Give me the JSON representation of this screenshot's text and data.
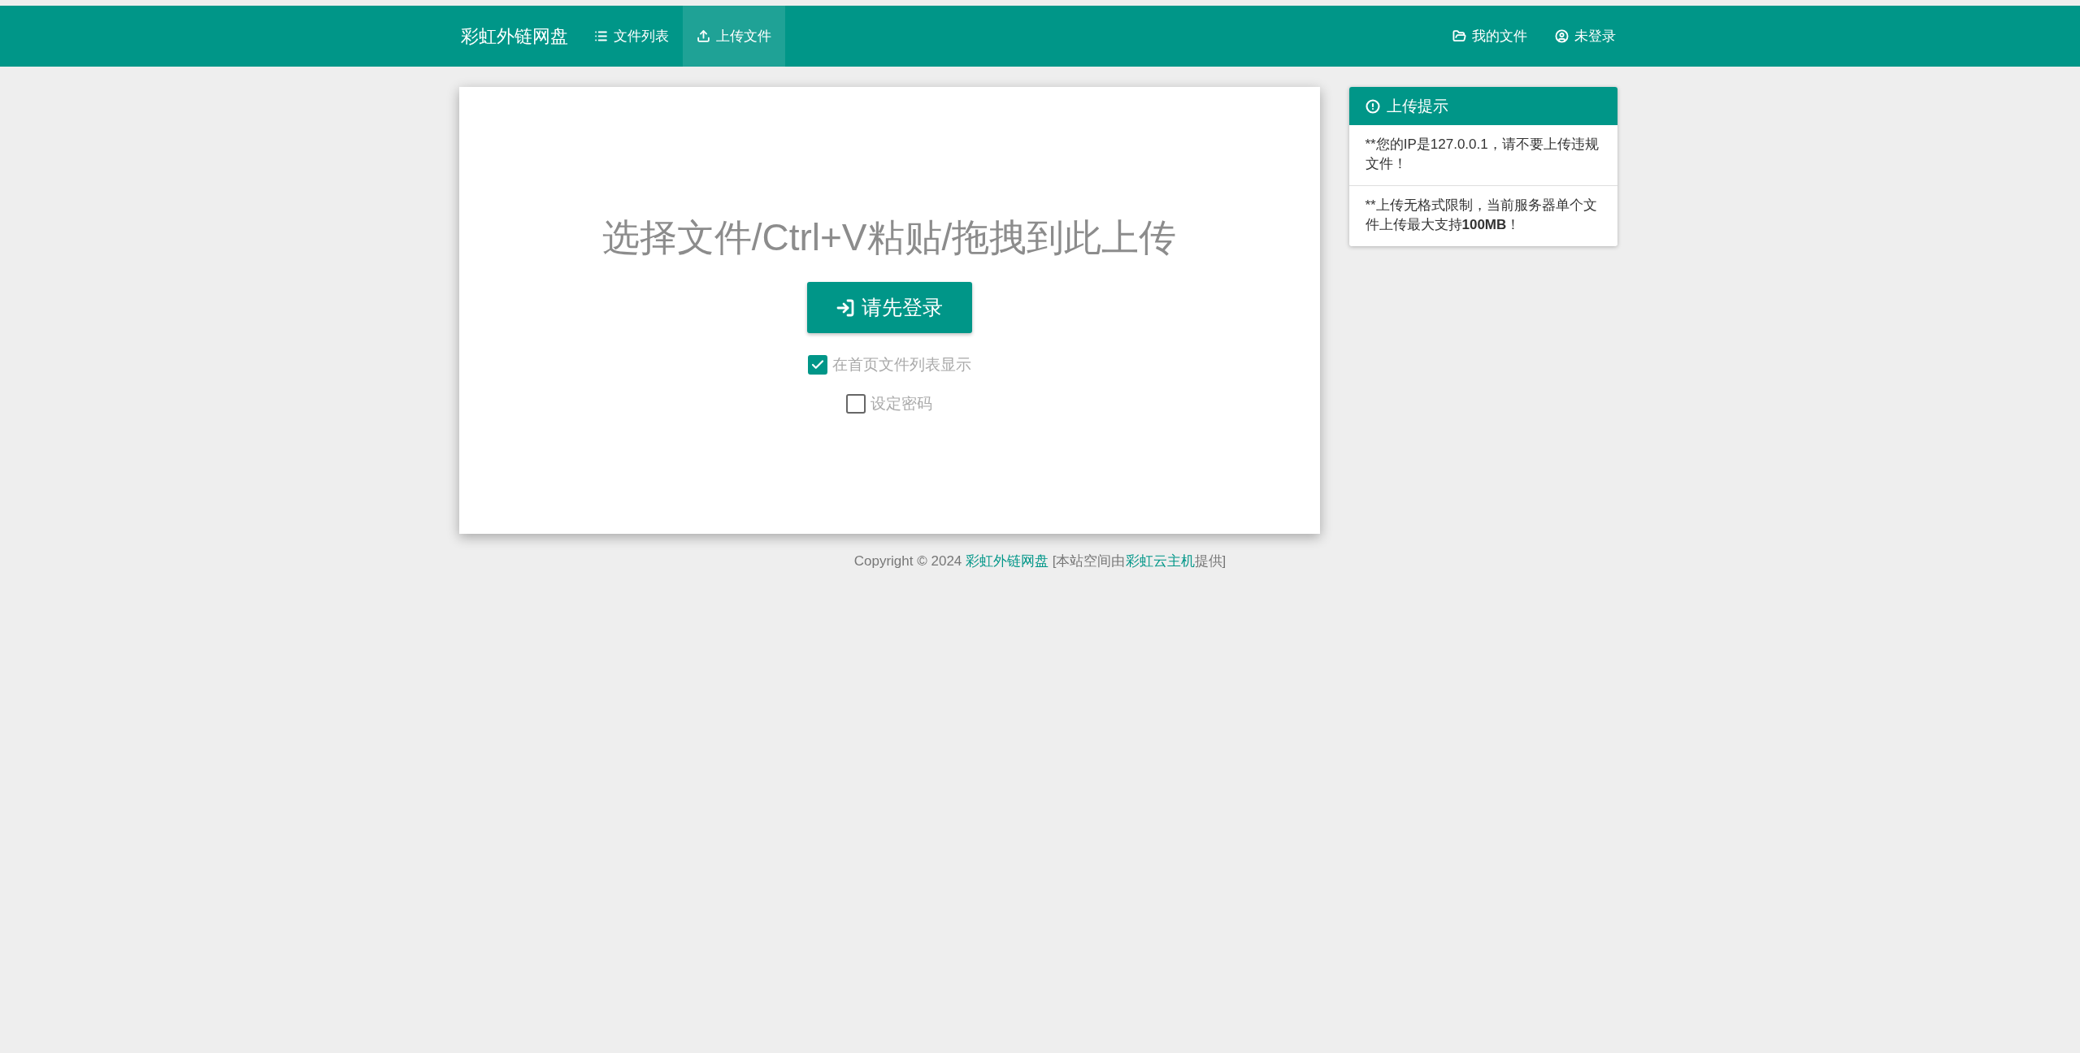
{
  "navbar": {
    "brand": "彩虹外链网盘",
    "left_items": [
      {
        "label": "文件列表",
        "selected": false
      },
      {
        "label": "上传文件",
        "selected": true
      }
    ],
    "right_items": [
      {
        "label": "我的文件",
        "selected": false
      },
      {
        "label": "未登录",
        "selected": false
      }
    ]
  },
  "upload": {
    "title": "选择文件/Ctrl+V粘贴/拖拽到此上传",
    "button": "请先登录",
    "options": [
      {
        "label": "在首页文件列表显示",
        "checked": true
      },
      {
        "label": "设定密码",
        "checked": false
      }
    ]
  },
  "notice": {
    "title": "上传提示",
    "items": [
      {
        "marker": "**",
        "text": "您的IP是127.0.0.1，请不要上传违规文件！"
      },
      {
        "marker": "**",
        "text": "上传无格式限制，当前服务器单个文件上传最大支持**100MB**！"
      }
    ]
  },
  "footer": {
    "prefix": "Copyright © 2024",
    "site_link": "彩虹外链网盘",
    "host_before": "[本站空间由",
    "host_link": "彩虹云主机",
    "host_after": "提供]"
  }
}
